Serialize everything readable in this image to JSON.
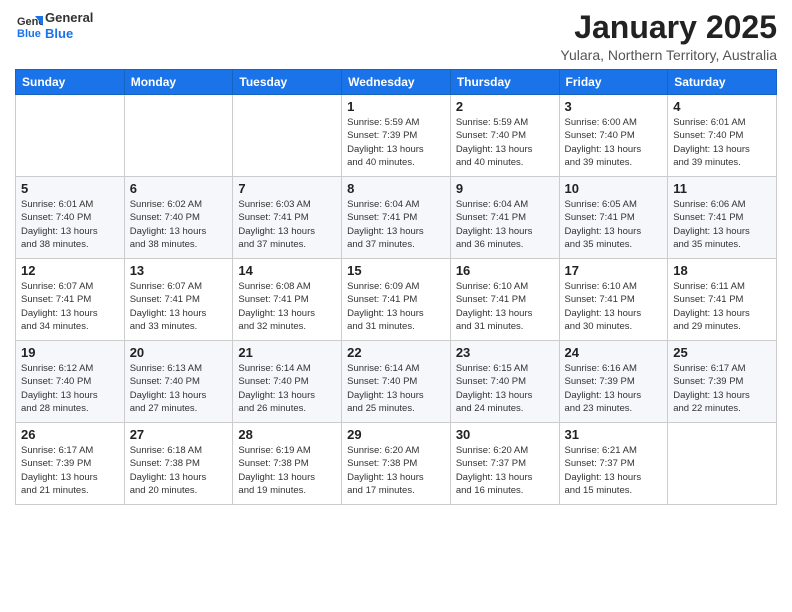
{
  "header": {
    "logo_line1": "General",
    "logo_line2": "Blue",
    "month_title": "January 2025",
    "location": "Yulara, Northern Territory, Australia"
  },
  "weekdays": [
    "Sunday",
    "Monday",
    "Tuesday",
    "Wednesday",
    "Thursday",
    "Friday",
    "Saturday"
  ],
  "weeks": [
    [
      {
        "day": "",
        "info": ""
      },
      {
        "day": "",
        "info": ""
      },
      {
        "day": "",
        "info": ""
      },
      {
        "day": "1",
        "info": "Sunrise: 5:59 AM\nSunset: 7:39 PM\nDaylight: 13 hours\nand 40 minutes."
      },
      {
        "day": "2",
        "info": "Sunrise: 5:59 AM\nSunset: 7:40 PM\nDaylight: 13 hours\nand 40 minutes."
      },
      {
        "day": "3",
        "info": "Sunrise: 6:00 AM\nSunset: 7:40 PM\nDaylight: 13 hours\nand 39 minutes."
      },
      {
        "day": "4",
        "info": "Sunrise: 6:01 AM\nSunset: 7:40 PM\nDaylight: 13 hours\nand 39 minutes."
      }
    ],
    [
      {
        "day": "5",
        "info": "Sunrise: 6:01 AM\nSunset: 7:40 PM\nDaylight: 13 hours\nand 38 minutes."
      },
      {
        "day": "6",
        "info": "Sunrise: 6:02 AM\nSunset: 7:40 PM\nDaylight: 13 hours\nand 38 minutes."
      },
      {
        "day": "7",
        "info": "Sunrise: 6:03 AM\nSunset: 7:41 PM\nDaylight: 13 hours\nand 37 minutes."
      },
      {
        "day": "8",
        "info": "Sunrise: 6:04 AM\nSunset: 7:41 PM\nDaylight: 13 hours\nand 37 minutes."
      },
      {
        "day": "9",
        "info": "Sunrise: 6:04 AM\nSunset: 7:41 PM\nDaylight: 13 hours\nand 36 minutes."
      },
      {
        "day": "10",
        "info": "Sunrise: 6:05 AM\nSunset: 7:41 PM\nDaylight: 13 hours\nand 35 minutes."
      },
      {
        "day": "11",
        "info": "Sunrise: 6:06 AM\nSunset: 7:41 PM\nDaylight: 13 hours\nand 35 minutes."
      }
    ],
    [
      {
        "day": "12",
        "info": "Sunrise: 6:07 AM\nSunset: 7:41 PM\nDaylight: 13 hours\nand 34 minutes."
      },
      {
        "day": "13",
        "info": "Sunrise: 6:07 AM\nSunset: 7:41 PM\nDaylight: 13 hours\nand 33 minutes."
      },
      {
        "day": "14",
        "info": "Sunrise: 6:08 AM\nSunset: 7:41 PM\nDaylight: 13 hours\nand 32 minutes."
      },
      {
        "day": "15",
        "info": "Sunrise: 6:09 AM\nSunset: 7:41 PM\nDaylight: 13 hours\nand 31 minutes."
      },
      {
        "day": "16",
        "info": "Sunrise: 6:10 AM\nSunset: 7:41 PM\nDaylight: 13 hours\nand 31 minutes."
      },
      {
        "day": "17",
        "info": "Sunrise: 6:10 AM\nSunset: 7:41 PM\nDaylight: 13 hours\nand 30 minutes."
      },
      {
        "day": "18",
        "info": "Sunrise: 6:11 AM\nSunset: 7:41 PM\nDaylight: 13 hours\nand 29 minutes."
      }
    ],
    [
      {
        "day": "19",
        "info": "Sunrise: 6:12 AM\nSunset: 7:40 PM\nDaylight: 13 hours\nand 28 minutes."
      },
      {
        "day": "20",
        "info": "Sunrise: 6:13 AM\nSunset: 7:40 PM\nDaylight: 13 hours\nand 27 minutes."
      },
      {
        "day": "21",
        "info": "Sunrise: 6:14 AM\nSunset: 7:40 PM\nDaylight: 13 hours\nand 26 minutes."
      },
      {
        "day": "22",
        "info": "Sunrise: 6:14 AM\nSunset: 7:40 PM\nDaylight: 13 hours\nand 25 minutes."
      },
      {
        "day": "23",
        "info": "Sunrise: 6:15 AM\nSunset: 7:40 PM\nDaylight: 13 hours\nand 24 minutes."
      },
      {
        "day": "24",
        "info": "Sunrise: 6:16 AM\nSunset: 7:39 PM\nDaylight: 13 hours\nand 23 minutes."
      },
      {
        "day": "25",
        "info": "Sunrise: 6:17 AM\nSunset: 7:39 PM\nDaylight: 13 hours\nand 22 minutes."
      }
    ],
    [
      {
        "day": "26",
        "info": "Sunrise: 6:17 AM\nSunset: 7:39 PM\nDaylight: 13 hours\nand 21 minutes."
      },
      {
        "day": "27",
        "info": "Sunrise: 6:18 AM\nSunset: 7:38 PM\nDaylight: 13 hours\nand 20 minutes."
      },
      {
        "day": "28",
        "info": "Sunrise: 6:19 AM\nSunset: 7:38 PM\nDaylight: 13 hours\nand 19 minutes."
      },
      {
        "day": "29",
        "info": "Sunrise: 6:20 AM\nSunset: 7:38 PM\nDaylight: 13 hours\nand 17 minutes."
      },
      {
        "day": "30",
        "info": "Sunrise: 6:20 AM\nSunset: 7:37 PM\nDaylight: 13 hours\nand 16 minutes."
      },
      {
        "day": "31",
        "info": "Sunrise: 6:21 AM\nSunset: 7:37 PM\nDaylight: 13 hours\nand 15 minutes."
      },
      {
        "day": "",
        "info": ""
      }
    ]
  ]
}
